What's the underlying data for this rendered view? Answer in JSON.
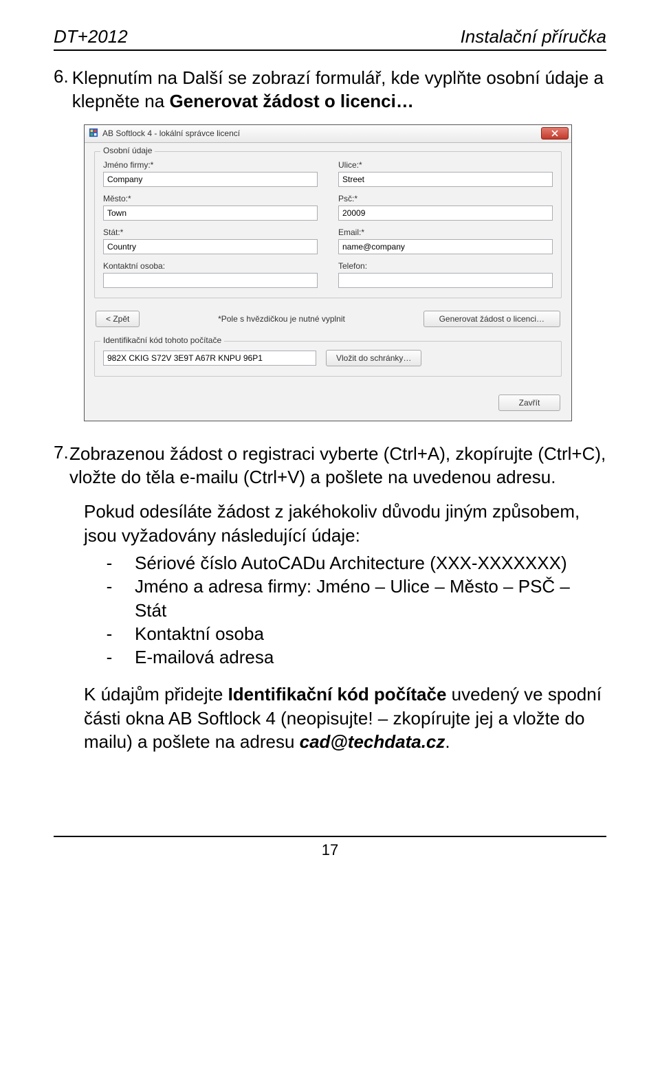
{
  "header": {
    "left": "DT+2012",
    "right": "Instalační příručka"
  },
  "step6": {
    "num": "6.",
    "text_before": "Klepnutím na Další se zobrazí formulář, kde vyplňte osobní údaje a klepněte na ",
    "bold": "Generovat žádost o licenci…"
  },
  "dialog": {
    "title": "AB Softlock 4   -   lokální správce licencí",
    "osobni": {
      "legend": "Osobní údaje",
      "jmeno_firmy_label": "Jméno firmy:*",
      "jmeno_firmy_value": "Company",
      "ulice_label": "Ulice:*",
      "ulice_value": "Street",
      "mesto_label": "Město:*",
      "mesto_value": "Town",
      "psc_label": "Psč:*",
      "psc_value": "20009",
      "stat_label": "Stát:*",
      "stat_value": "Country",
      "email_label": "Email:*",
      "email_value": "name@company",
      "kontakt_label": "Kontaktní osoba:",
      "kontakt_value": "",
      "telefon_label": "Telefon:",
      "telefon_value": ""
    },
    "back_btn": "< Zpět",
    "required_note": "*Pole s hvězdičkou je nutné vyplnit",
    "generate_btn": "Generovat žádost o licenci…",
    "id_legend": "Identifikační kód tohoto počítače",
    "id_value": "982X CKIG S72V 3E9T A67R KNPU 96P1",
    "clipboard_btn": "Vložit do schránky…",
    "close_btn": "Zavřít"
  },
  "step7": {
    "num": "7.",
    "text": "Zobrazenou žádost o registraci vyberte (Ctrl+A), zkopírujte (Ctrl+C), vložte do těla e-mailu (Ctrl+V) a pošlete na uvedenou adresu."
  },
  "para1": {
    "lead": "Pokud odesíláte žádost z jakéhokoliv důvodu jiným způsobem, jsou vyžadovány následující údaje:",
    "items": [
      "Sériové číslo AutoCADu Architecture (XXX-XXXXXXX)",
      "Jméno a adresa firmy: Jméno – Ulice – Město – PSČ – Stát",
      "Kontaktní osoba",
      "E-mailová adresa"
    ]
  },
  "final": {
    "t1": "K údajům přidejte ",
    "bold": "Identifikační kód počítače",
    "t2": " uvedený ve spodní části okna AB Softlock 4 (neopisujte! – zkopírujte jej a vložte do mailu) a pošlete na adresu ",
    "email": "cad@techdata.cz",
    "t3": "."
  },
  "footer": {
    "page": "17"
  }
}
